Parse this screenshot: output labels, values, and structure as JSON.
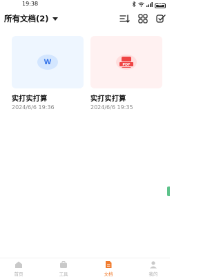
{
  "status_bar": {
    "time": "19:38",
    "battery": "96"
  },
  "header": {
    "title": "所有文档(2)"
  },
  "documents": [
    {
      "name": "实打实打算",
      "date": "2024/6/6 19:36",
      "type": "word",
      "badge": "W"
    },
    {
      "name": "实打实打算",
      "date": "2024/6/6 19:35",
      "type": "pdf",
      "badge": "PDF"
    }
  ],
  "tabbar": {
    "tabs": [
      {
        "label": "首页",
        "active": false
      },
      {
        "label": "工具",
        "active": false
      },
      {
        "label": "文档",
        "active": true
      },
      {
        "label": "我的",
        "active": false
      }
    ]
  },
  "colors": {
    "accent": "#f07b2e",
    "word": "#2b6de8",
    "pdf": "#ef4444"
  }
}
